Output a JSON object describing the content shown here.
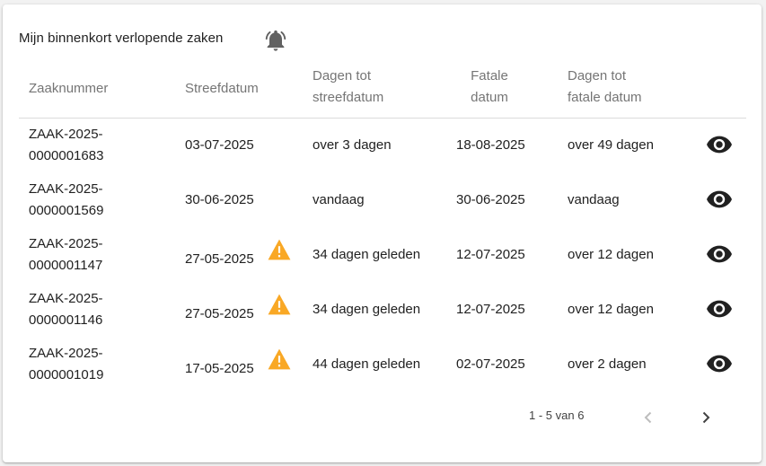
{
  "card": {
    "title": "Mijn binnenkort verlopende zaken",
    "bell_icon": "alarm-bell-icon"
  },
  "table": {
    "columns": {
      "zaaknummer": "Zaaknummer",
      "streefdatum": "Streefdatum",
      "dagen_tot_streefdatum_line1": "Dagen tot",
      "dagen_tot_streefdatum_line2": "streefdatum",
      "fatale_datum_line1": "Fatale",
      "fatale_datum_line2": "datum",
      "dagen_tot_fatale_datum_line1": "Dagen tot",
      "dagen_tot_fatale_datum_line2": "fatale datum"
    },
    "rows": [
      {
        "zaak_line1": "ZAAK-2025-",
        "zaak_line2": "0000001683",
        "streefdatum": "03-07-2025",
        "warning": false,
        "dagen_streef": "over 3 dagen",
        "fatale_datum": "18-08-2025",
        "dagen_fataal": "over 49 dagen"
      },
      {
        "zaak_line1": "ZAAK-2025-",
        "zaak_line2": "0000001569",
        "streefdatum": "30-06-2025",
        "warning": false,
        "dagen_streef": "vandaag",
        "fatale_datum": "30-06-2025",
        "dagen_fataal": "vandaag"
      },
      {
        "zaak_line1": "ZAAK-2025-",
        "zaak_line2": "0000001147",
        "streefdatum": "27-05-2025",
        "warning": true,
        "dagen_streef": "34 dagen geleden",
        "fatale_datum": "12-07-2025",
        "dagen_fataal": "over 12 dagen"
      },
      {
        "zaak_line1": "ZAAK-2025-",
        "zaak_line2": "0000001146",
        "streefdatum": "27-05-2025",
        "warning": true,
        "dagen_streef": "34 dagen geleden",
        "fatale_datum": "12-07-2025",
        "dagen_fataal": "over 12 dagen"
      },
      {
        "zaak_line1": "ZAAK-2025-",
        "zaak_line2": "0000001019",
        "streefdatum": "17-05-2025",
        "warning": true,
        "dagen_streef": "44 dagen geleden",
        "fatale_datum": "02-07-2025",
        "dagen_fataal": "over 2 dagen"
      }
    ],
    "row_icons": {
      "warning": "warning-triangle-icon",
      "view": "eye-icon"
    }
  },
  "pagination": {
    "range": "1 - 5 van 6",
    "prev_icon": "chevron-left-icon",
    "next_icon": "chevron-right-icon",
    "prev_disabled": true
  },
  "colors": {
    "warning": "#f9a825",
    "icon_dark": "#212121",
    "icon_muted": "#616161",
    "header_text": "#757575",
    "divider": "#dcdcdc",
    "disabled": "#bdbdbd"
  }
}
